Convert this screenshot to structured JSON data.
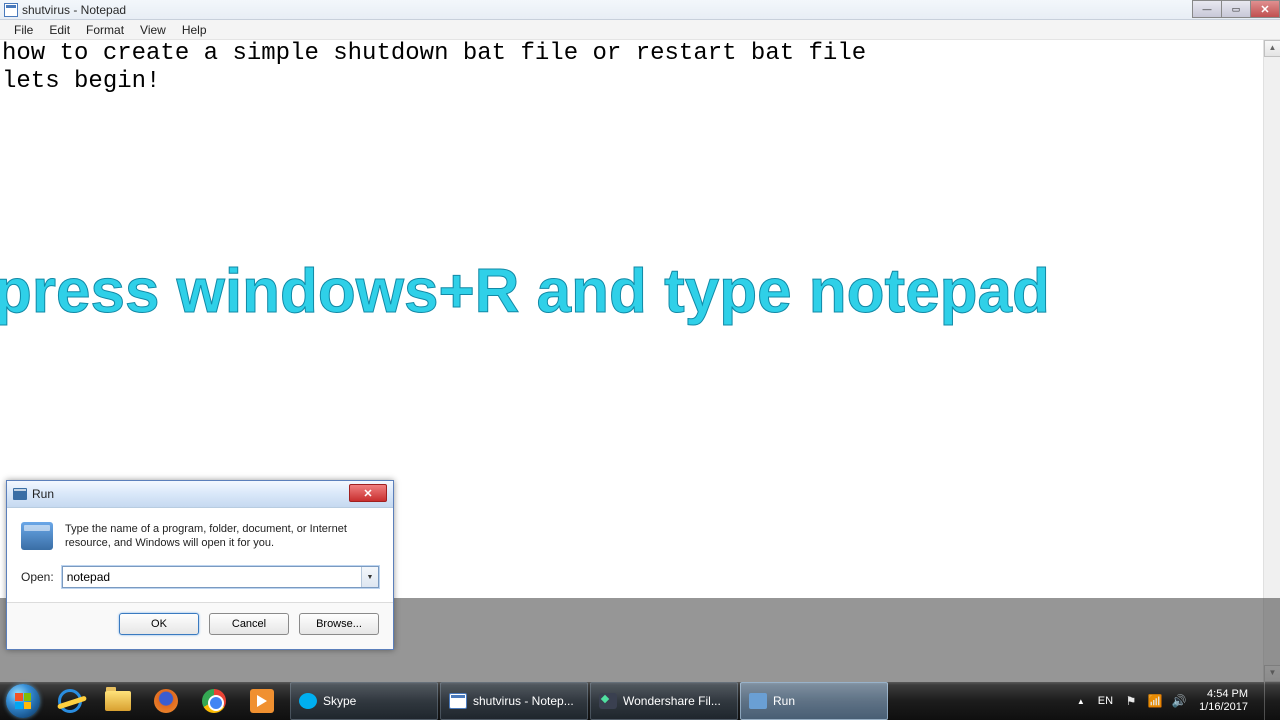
{
  "notepad": {
    "title": "shutvirus - Notepad",
    "menu": {
      "file": "File",
      "edit": "Edit",
      "format": "Format",
      "view": "View",
      "help": "Help"
    },
    "content": "how to create a simple shutdown bat file or restart bat file\nlets begin!"
  },
  "caption": "press windows+R and type notepad",
  "run": {
    "title": "Run",
    "desc": "Type the name of a program, folder, document, or Internet resource, and Windows will open it for you.",
    "open_label": "Open:",
    "open_value": "notepad",
    "ok": "OK",
    "cancel": "Cancel",
    "browse": "Browse..."
  },
  "taskbar": {
    "items": [
      {
        "label": "Skype"
      },
      {
        "label": "shutvirus - Notep..."
      },
      {
        "label": "Wondershare Fil..."
      },
      {
        "label": "Run"
      }
    ],
    "lang": "EN",
    "time": "4:54 PM",
    "date": "1/16/2017"
  }
}
